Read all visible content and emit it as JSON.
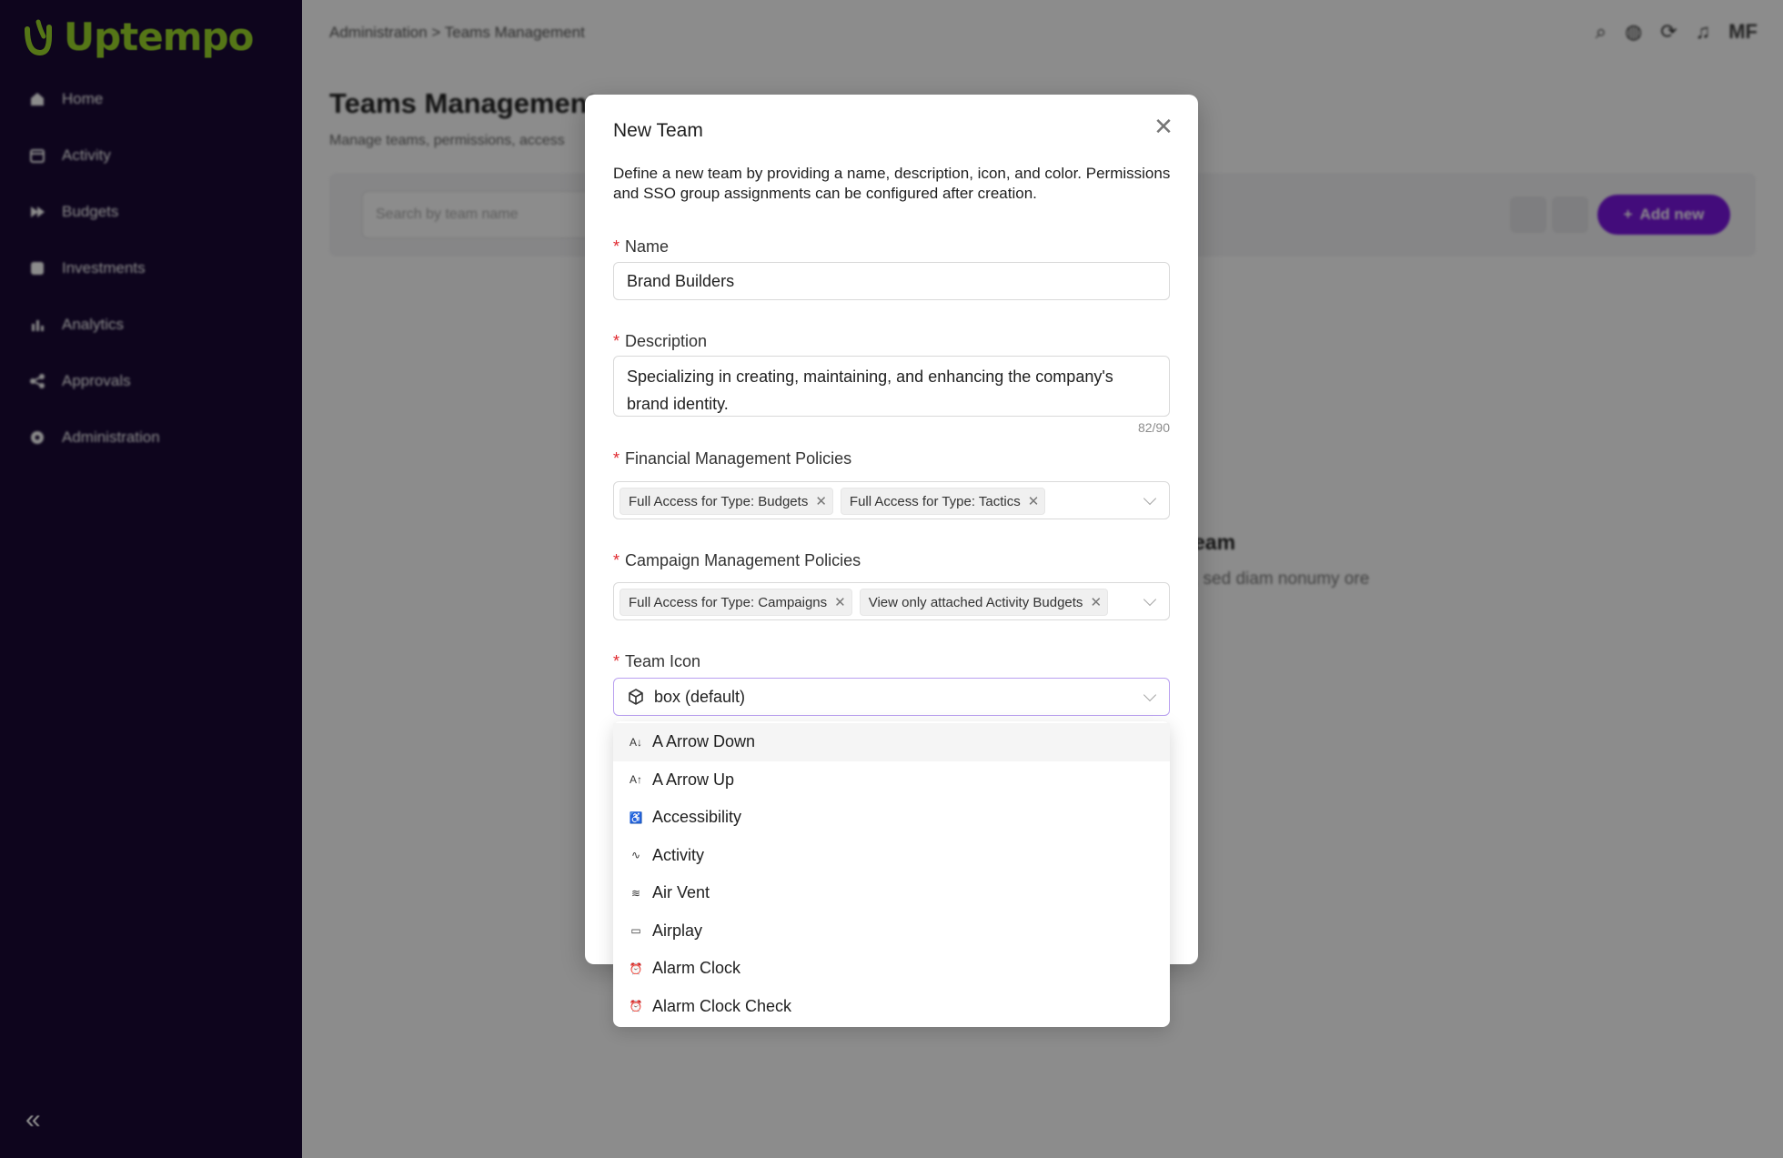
{
  "app": {
    "logo_text": "Uptempo",
    "brand_color": "#9bd82a",
    "sidebar_bg": "#1a0a36",
    "accent": "#7b16e0"
  },
  "sidebar": {
    "items": [
      {
        "label": "Home",
        "icon": "home-icon"
      },
      {
        "label": "Activity",
        "icon": "calendar-icon"
      },
      {
        "label": "Budgets",
        "icon": "budgets-icon"
      },
      {
        "label": "Investments",
        "icon": "investments-icon"
      },
      {
        "label": "Analytics",
        "icon": "bar-chart-icon"
      },
      {
        "label": "Approvals",
        "icon": "share-icon"
      },
      {
        "label": "Administration",
        "icon": "gear-icon"
      }
    ],
    "collapse_glyph": "«"
  },
  "header": {
    "breadcrumb": "Administration > Teams Management",
    "user_initials": "MF"
  },
  "page": {
    "title": "Teams Management",
    "subtitle": "Manage teams, permissions, access",
    "search_placeholder": "Search by team name",
    "add_label": "Add new",
    "empty_title": "eam",
    "empty_text": ", sed diam nonumy ore"
  },
  "modal": {
    "title": "New Team",
    "close_glyph": "✕",
    "description": "Define a new team by providing a name, description, icon, and color. Permissions and SSO group assignments can be configured after creation.",
    "name": {
      "label": "Name",
      "value": "Brand Builders"
    },
    "description_field": {
      "label": "Description",
      "value": "Specializing in creating, maintaining, and enhancing the company's brand identity.",
      "counter": "82/90"
    },
    "financial": {
      "label": "Financial Management Policies",
      "tags": [
        "Full Access for Type: Budgets",
        "Full Access for Type: Tactics"
      ]
    },
    "campaign": {
      "label": "Campaign Management Policies",
      "tags": [
        "Full Access for Type: Campaigns",
        "View only attached Activity Budgets"
      ]
    },
    "team_icon": {
      "label": "Team Icon",
      "value": "box (default)",
      "icon": "box-icon"
    }
  },
  "dropdown": {
    "options": [
      {
        "label": "A Arrow Down",
        "icon": "a-arrow-down-icon",
        "glyph": "A↓"
      },
      {
        "label": "A Arrow Up",
        "icon": "a-arrow-up-icon",
        "glyph": "A↑"
      },
      {
        "label": "Accessibility",
        "icon": "accessibility-icon",
        "glyph": "♿"
      },
      {
        "label": "Activity",
        "icon": "activity-icon",
        "glyph": "∿"
      },
      {
        "label": "Air Vent",
        "icon": "air-vent-icon",
        "glyph": "≋"
      },
      {
        "label": "Airplay",
        "icon": "airplay-icon",
        "glyph": "▭"
      },
      {
        "label": "Alarm Clock",
        "icon": "alarm-clock-icon",
        "glyph": "⏰"
      },
      {
        "label": "Alarm Clock Check",
        "icon": "alarm-clock-check-icon",
        "glyph": "⏰"
      }
    ]
  }
}
